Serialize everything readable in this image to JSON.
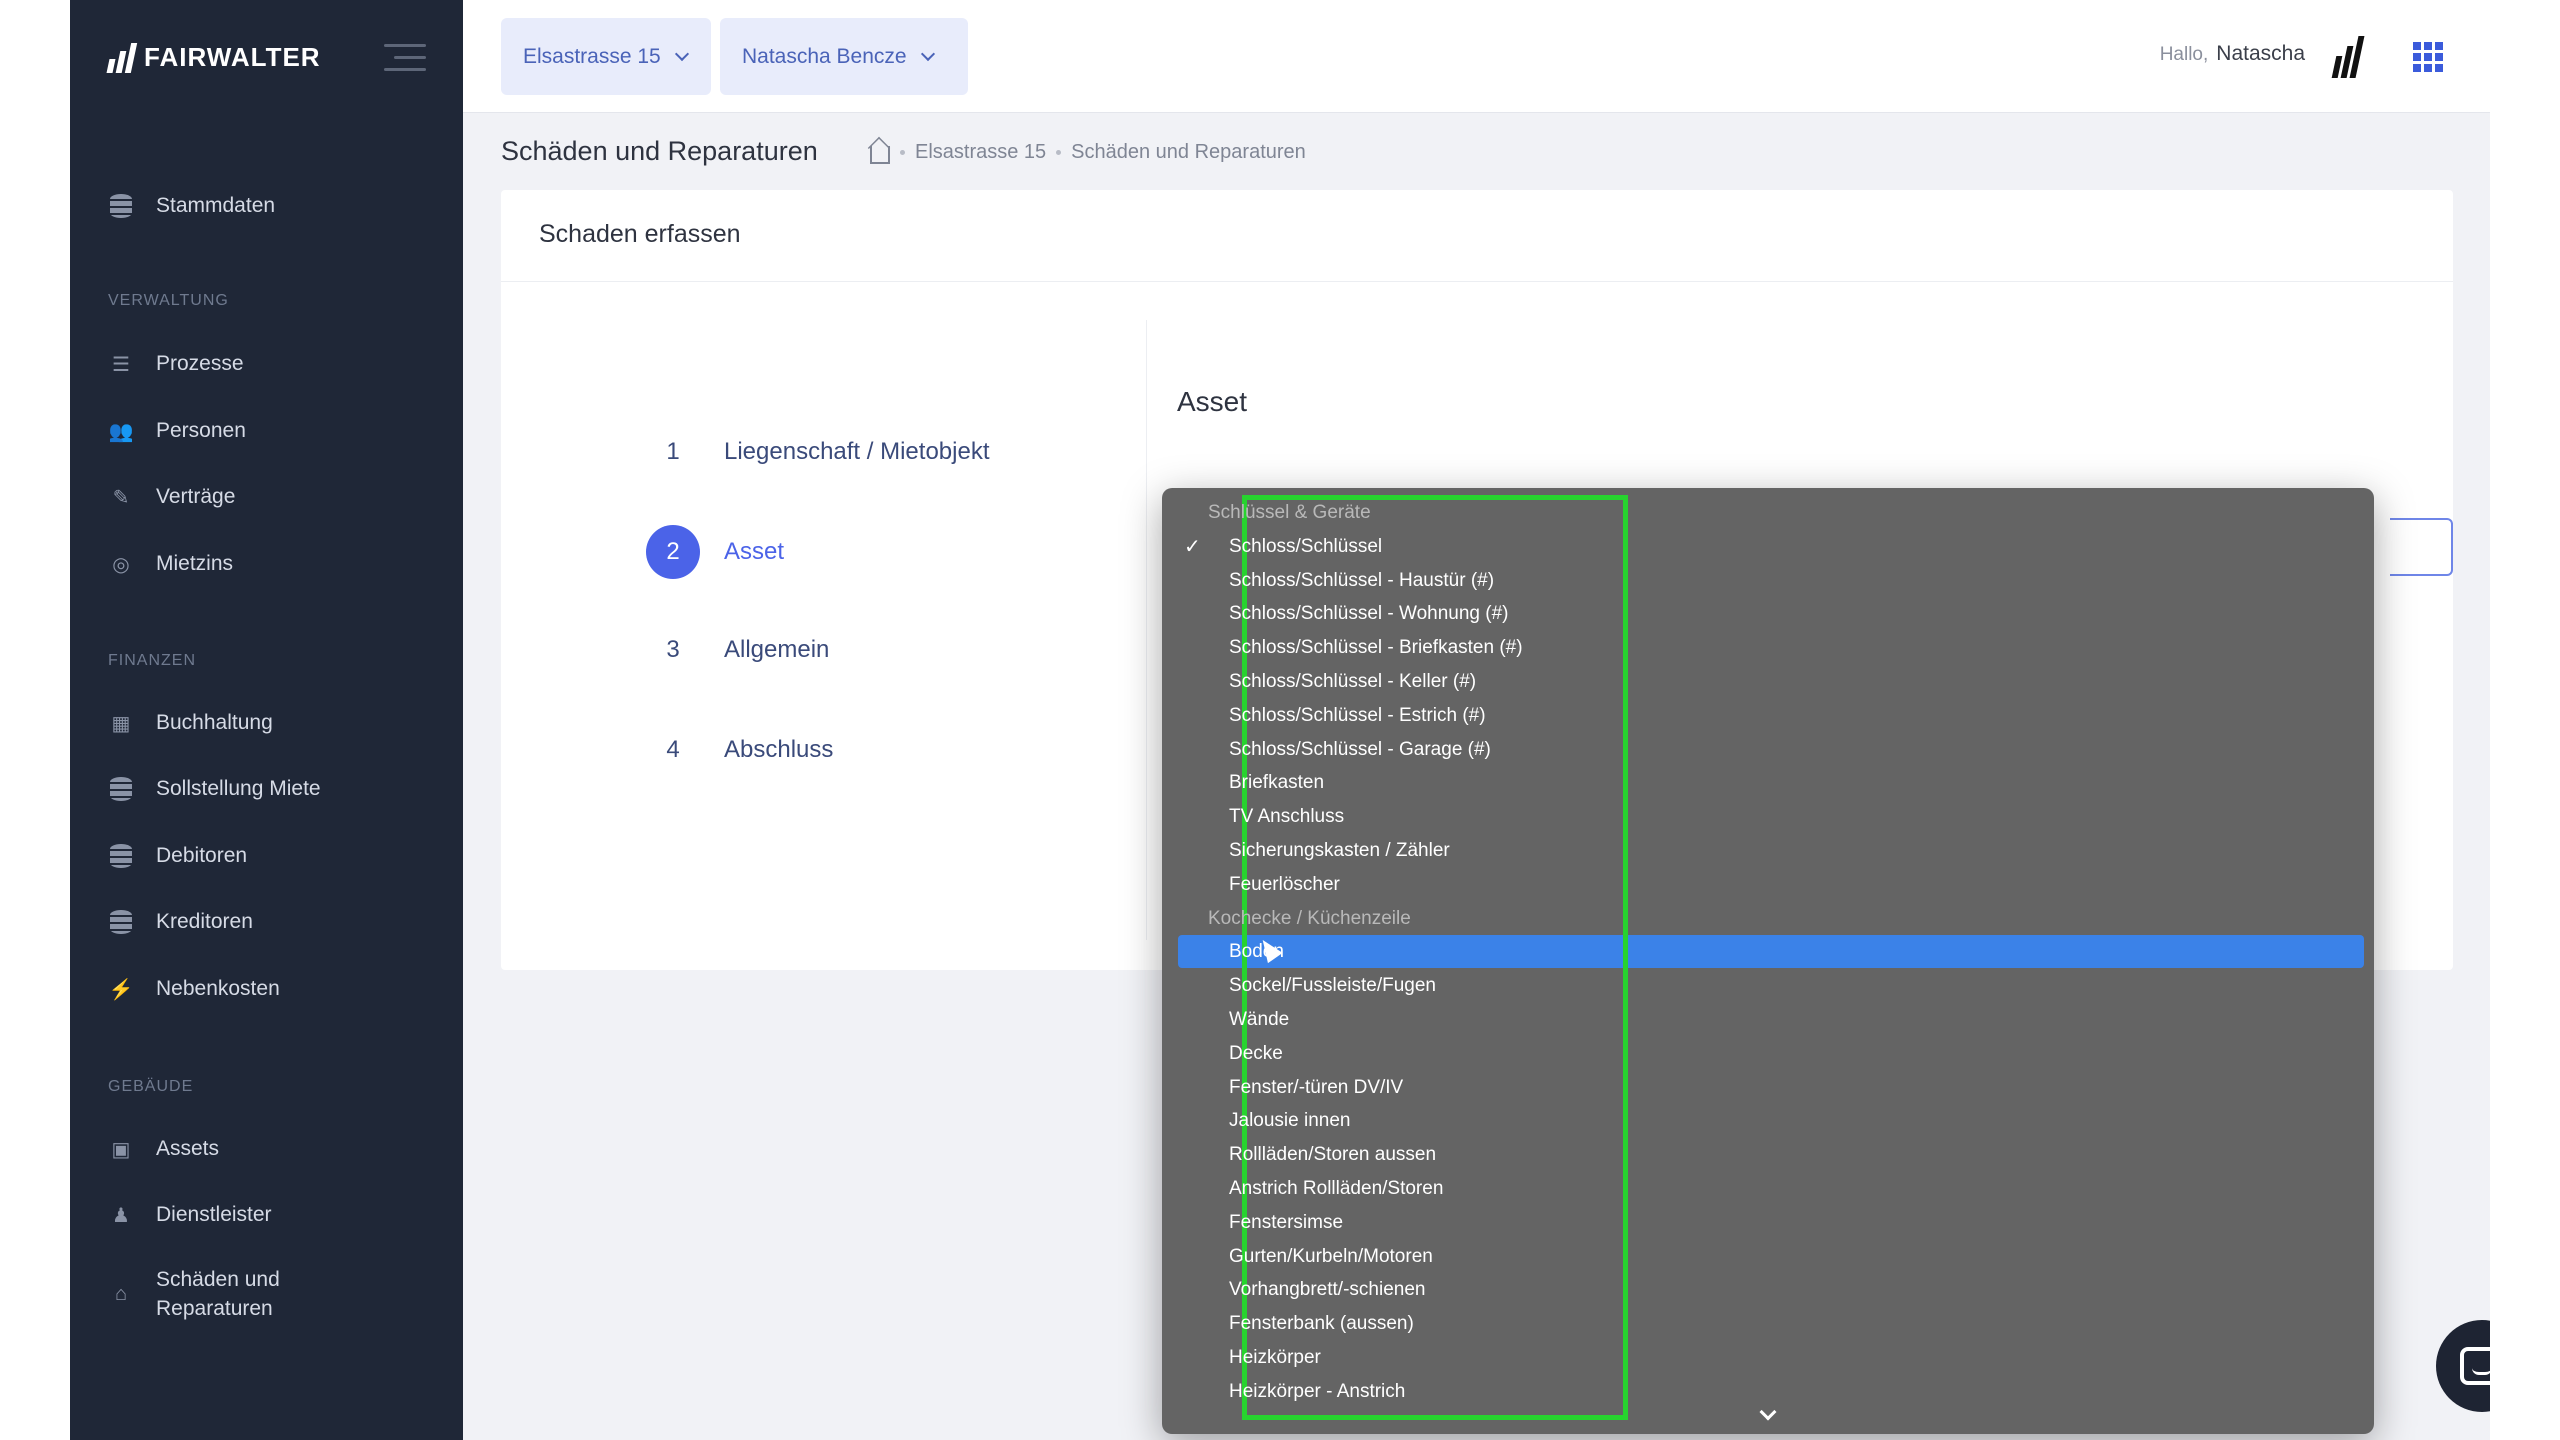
{
  "app": {
    "brand": "FAIRWALTER"
  },
  "sidebar": {
    "top_item": "Stammdaten",
    "sections": [
      {
        "title": "VERWALTUNG",
        "items": [
          "Prozesse",
          "Personen",
          "Verträge",
          "Mietzins"
        ]
      },
      {
        "title": "FINANZEN",
        "items": [
          "Buchhaltung",
          "Sollstellung Miete",
          "Debitoren",
          "Kreditoren",
          "Nebenkosten"
        ]
      },
      {
        "title": "GEBÄUDE",
        "items": [
          "Assets",
          "Dienstleister",
          "Schäden und\nReparaturen"
        ]
      }
    ]
  },
  "header": {
    "property_select": "Elsastrasse 15",
    "person_select": "Natascha Bencze",
    "greeting": "Hallo,",
    "user_name": "Natascha"
  },
  "page": {
    "title": "Schäden und Reparaturen",
    "breadcrumb": [
      "Elsastrasse 15",
      "Schäden und Reparaturen"
    ]
  },
  "card": {
    "title": "Schaden erfassen",
    "steps": [
      {
        "num": "1",
        "label": "Liegenschaft / Mietobjekt"
      },
      {
        "num": "2",
        "label": "Asset"
      },
      {
        "num": "3",
        "label": "Allgemein"
      },
      {
        "num": "4",
        "label": "Abschluss"
      }
    ],
    "active_step": 2,
    "section_title": "Asset"
  },
  "dropdown": {
    "rows": [
      {
        "type": "group",
        "label": "Schlüssel & Geräte"
      },
      {
        "type": "option",
        "label": "Schloss/Schlüssel",
        "checked": true
      },
      {
        "type": "option",
        "label": "Schloss/Schlüssel - Haustür (#)"
      },
      {
        "type": "option",
        "label": "Schloss/Schlüssel - Wohnung (#)"
      },
      {
        "type": "option",
        "label": "Schloss/Schlüssel - Briefkasten (#)"
      },
      {
        "type": "option",
        "label": "Schloss/Schlüssel - Keller (#)"
      },
      {
        "type": "option",
        "label": "Schloss/Schlüssel - Estrich (#)"
      },
      {
        "type": "option",
        "label": "Schloss/Schlüssel - Garage (#)"
      },
      {
        "type": "option",
        "label": "Briefkasten"
      },
      {
        "type": "option",
        "label": "TV Anschluss"
      },
      {
        "type": "option",
        "label": "Sicherungskasten / Zähler"
      },
      {
        "type": "option",
        "label": "Feuerlöscher"
      },
      {
        "type": "group",
        "label": "Kochecke / Küchenzeile"
      },
      {
        "type": "option",
        "label": "Boden",
        "highlighted": true
      },
      {
        "type": "option",
        "label": "Sockel/Fussleiste/Fugen"
      },
      {
        "type": "option",
        "label": "Wände"
      },
      {
        "type": "option",
        "label": "Decke"
      },
      {
        "type": "option",
        "label": "Fenster/-türen DV/IV"
      },
      {
        "type": "option",
        "label": "Jalousie innen"
      },
      {
        "type": "option",
        "label": "Rollläden/Storen aussen"
      },
      {
        "type": "option",
        "label": "Anstrich Rollläden/Storen"
      },
      {
        "type": "option",
        "label": "Fenstersimse"
      },
      {
        "type": "option",
        "label": "Gurten/Kurbeln/Motoren"
      },
      {
        "type": "option",
        "label": "Vorhangbrett/-schienen"
      },
      {
        "type": "option",
        "label": "Fensterbank (aussen)"
      },
      {
        "type": "option",
        "label": "Heizkörper"
      },
      {
        "type": "option",
        "label": "Heizkörper - Anstrich"
      }
    ]
  },
  "colors": {
    "sidebar_bg": "#1f2737",
    "accent": "#4b63e8",
    "highlight": "#3b82e8",
    "annotation_box": "#27d32f"
  }
}
